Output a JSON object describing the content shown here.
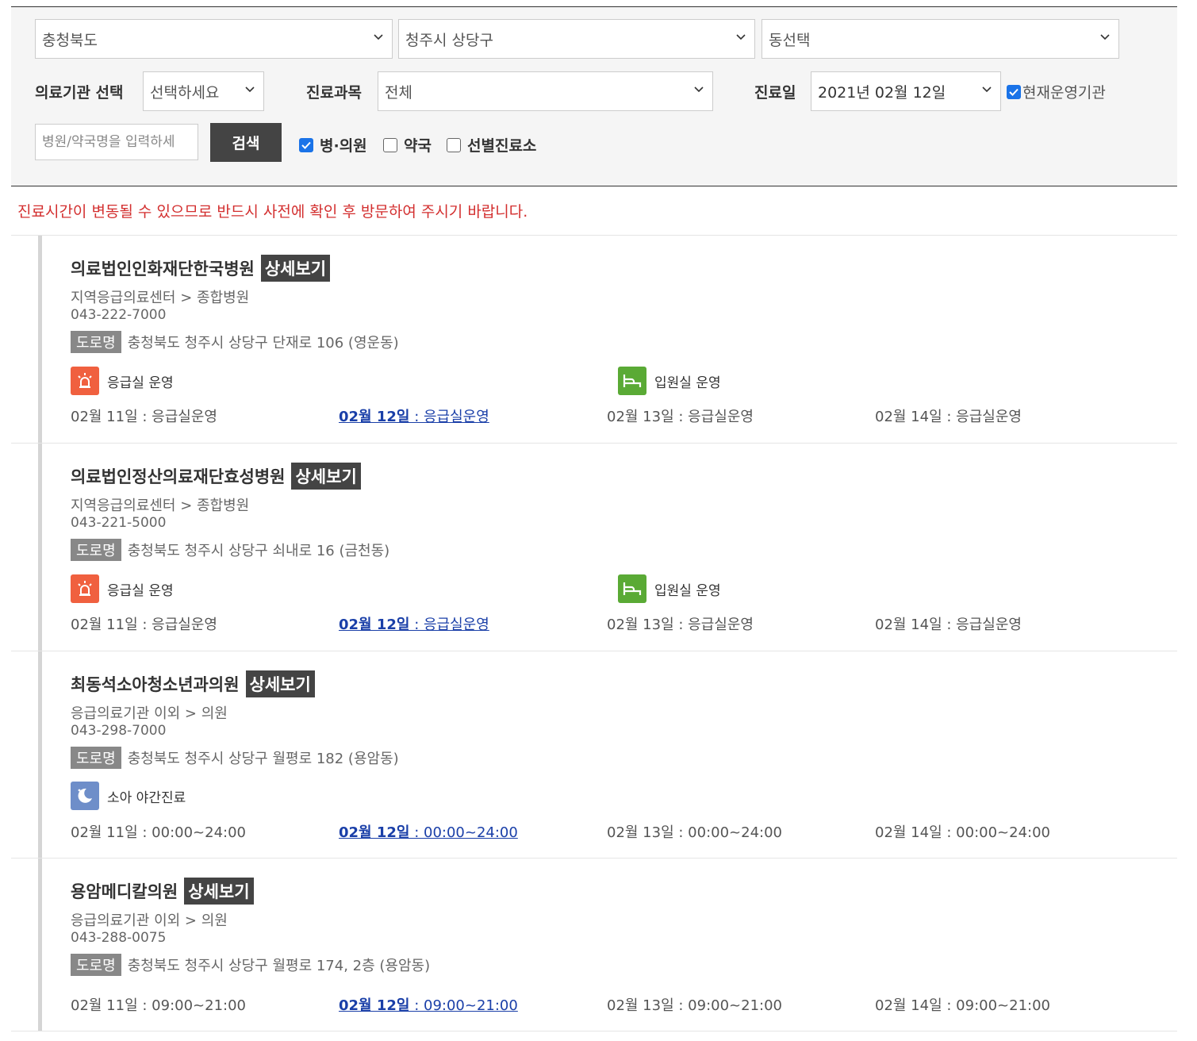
{
  "filters": {
    "province": "충청북도",
    "city": "청주시 상당구",
    "dong": "동선택",
    "institution_label": "의료기관 선택",
    "institution_value": "선택하세요",
    "subject_label": "진료과목",
    "subject_value": "전체",
    "date_label": "진료일",
    "date_value": "2021년 02월 12일",
    "open_now_label": "현재운영기관",
    "search_placeholder": "병원/약국명을 입력하세",
    "search_button": "검색",
    "type_hospital": "병·의원",
    "type_pharmacy": "약국",
    "type_screening": "선별진료소"
  },
  "notice": "진료시간이 변동될 수 있으므로 반드시 사전에 확인 후 방문하여 주시기 바랍니다.",
  "detail_label": "상세보기",
  "road_label": "도로명",
  "hospitals": [
    {
      "name": "의료법인인화재단한국병원",
      "category": "지역응급의료센터 > 종합병원",
      "phone": "043-222-7000",
      "address": "충청북도 청주시 상당구 단재로 106 (영운동)",
      "services": [
        "응급실 운영",
        "입원실 운영"
      ],
      "days": [
        {
          "date": "02월 11일",
          "hours": " : 응급실운영"
        },
        {
          "date": "02월 12일",
          "hours": " : 응급실운영"
        },
        {
          "date": "02월 13일",
          "hours": " : 응급실운영"
        },
        {
          "date": "02월 14일",
          "hours": " : 응급실운영"
        }
      ]
    },
    {
      "name": "의료법인정산의료재단효성병원",
      "category": "지역응급의료센터 > 종합병원",
      "phone": "043-221-5000",
      "address": "충청북도 청주시 상당구 쇠내로 16 (금천동)",
      "services": [
        "응급실 운영",
        "입원실 운영"
      ],
      "days": [
        {
          "date": "02월 11일",
          "hours": " : 응급실운영"
        },
        {
          "date": "02월 12일",
          "hours": " : 응급실운영"
        },
        {
          "date": "02월 13일",
          "hours": " : 응급실운영"
        },
        {
          "date": "02월 14일",
          "hours": " : 응급실운영"
        }
      ]
    },
    {
      "name": "최동석소아청소년과의원",
      "category": "응급의료기관 이외 > 의원",
      "phone": "043-298-7000",
      "address": "충청북도 청주시 상당구 월평로 182 (용암동)",
      "services": [
        "소아 야간진료"
      ],
      "days": [
        {
          "date": "02월 11일",
          "hours": " : 00:00~24:00"
        },
        {
          "date": "02월 12일",
          "hours": " : 00:00~24:00"
        },
        {
          "date": "02월 13일",
          "hours": " : 00:00~24:00"
        },
        {
          "date": "02월 14일",
          "hours": " : 00:00~24:00"
        }
      ]
    },
    {
      "name": "용암메디칼의원",
      "category": "응급의료기관 이외 > 의원",
      "phone": "043-288-0075",
      "address": "충청북도 청주시 상당구 월평로 174, 2층 (용암동)",
      "days": [
        {
          "date": "02월 11일",
          "hours": " : 09:00~21:00"
        },
        {
          "date": "02월 12일",
          "hours": " : 09:00~21:00"
        },
        {
          "date": "02월 13일",
          "hours": " : 09:00~21:00"
        },
        {
          "date": "02월 14일",
          "hours": " : 09:00~21:00"
        }
      ]
    }
  ]
}
